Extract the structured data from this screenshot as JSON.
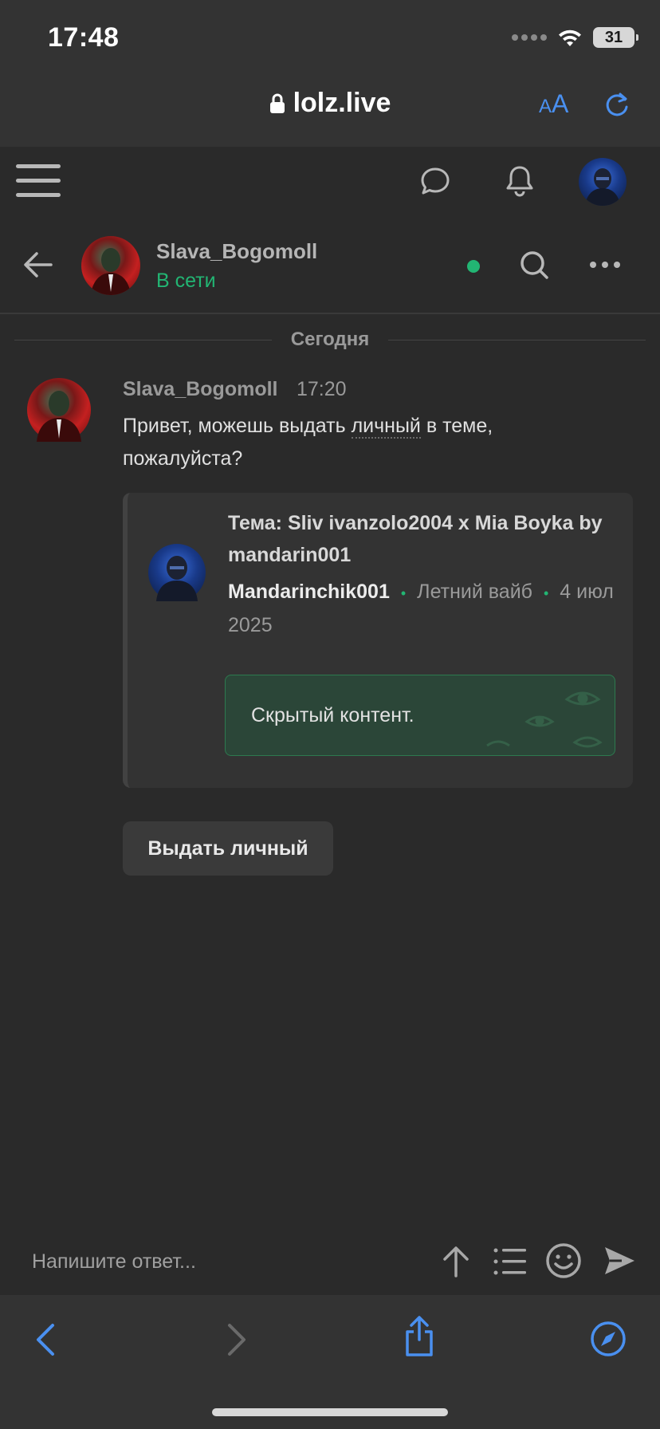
{
  "status_bar": {
    "time": "17:48",
    "battery": "31"
  },
  "browser": {
    "url": "lolz.live",
    "aa_label_small": "A",
    "aa_label_large": "A"
  },
  "conversation": {
    "name": "Slava_Bogomoll",
    "status": "В сети"
  },
  "date_divider": "Сегодня",
  "message": {
    "author": "Slava_Bogomoll",
    "time": "17:20",
    "text_before": "Привет, можешь выдать ",
    "text_link": "личный",
    "text_after": " в теме, пожалуйста?"
  },
  "quote": {
    "title": "Тема: Sliv ivanzolo2004 x Mia Boyka by mandarin001",
    "author": "Mandarinchik001",
    "section": "Летний вайб",
    "date": "4 июл 2025",
    "separator": "•",
    "hidden_text": "Скрытый контент."
  },
  "action_button": "Выдать личный",
  "reply": {
    "placeholder": "Напишите ответ..."
  },
  "colors": {
    "accent_green": "#22b573",
    "browser_blue": "#4a90f0",
    "background": "#2a2a2a"
  },
  "icons": [
    "lock-icon",
    "reload-icon",
    "menu-icon",
    "chat-icon",
    "bell-icon",
    "back-icon",
    "search-icon",
    "more-icon",
    "arrow-up-icon",
    "list-icon",
    "smile-icon",
    "send-icon",
    "nav-back-icon",
    "nav-forward-icon",
    "share-icon",
    "compass-icon"
  ]
}
